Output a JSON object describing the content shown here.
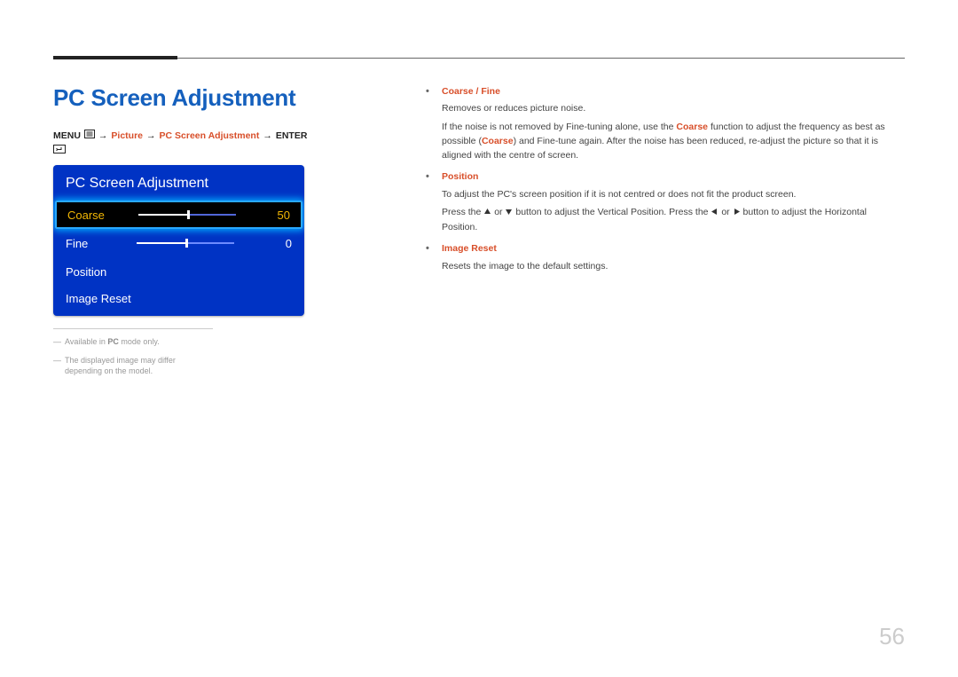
{
  "heading": "PC Screen Adjustment",
  "breadcrumb": {
    "menu": "MENU",
    "arrow": "→",
    "picture": "Picture",
    "pcsa": "PC Screen Adjustment",
    "enter": "ENTER"
  },
  "osd": {
    "title": "PC Screen Adjustment",
    "rows": [
      {
        "label": "Coarse",
        "value": "50",
        "fill": 50,
        "selected": true,
        "hasSlider": true
      },
      {
        "label": "Fine",
        "value": "0",
        "fill": 50,
        "selected": false,
        "hasSlider": true
      },
      {
        "label": "Position",
        "value": "",
        "fill": 0,
        "selected": false,
        "hasSlider": false
      },
      {
        "label": "Image Reset",
        "value": "",
        "fill": 0,
        "selected": false,
        "hasSlider": false
      }
    ]
  },
  "footnotes": {
    "note1_pre": "Available in ",
    "note1_bold": "PC",
    "note1_post": " mode only.",
    "note2": "The displayed image may differ depending on the model."
  },
  "descriptions": {
    "coarse_fine": {
      "title": "Coarse / Fine",
      "p1": "Removes or reduces picture noise.",
      "p2_a": "If the noise is not removed by Fine-tuning alone, use the ",
      "p2_bold1": "Coarse",
      "p2_b": " function to adjust the frequency as best as possible (",
      "p2_bold2": "Coarse",
      "p2_c": ") and Fine-tune again. After the noise has been reduced, re-adjust the picture so that it is aligned with the centre of screen."
    },
    "position": {
      "title": "Position",
      "p1": "To adjust the PC's screen position if it is not centred or does not fit the product screen.",
      "p2_a": "Press the ",
      "p2_b": " or ",
      "p2_c": " button to adjust the Vertical Position. Press the ",
      "p2_d": " or ",
      "p2_e": " button to adjust the Horizontal Position."
    },
    "image_reset": {
      "title": "Image Reset",
      "p1": "Resets the image to the default settings."
    }
  },
  "page_number": "56"
}
